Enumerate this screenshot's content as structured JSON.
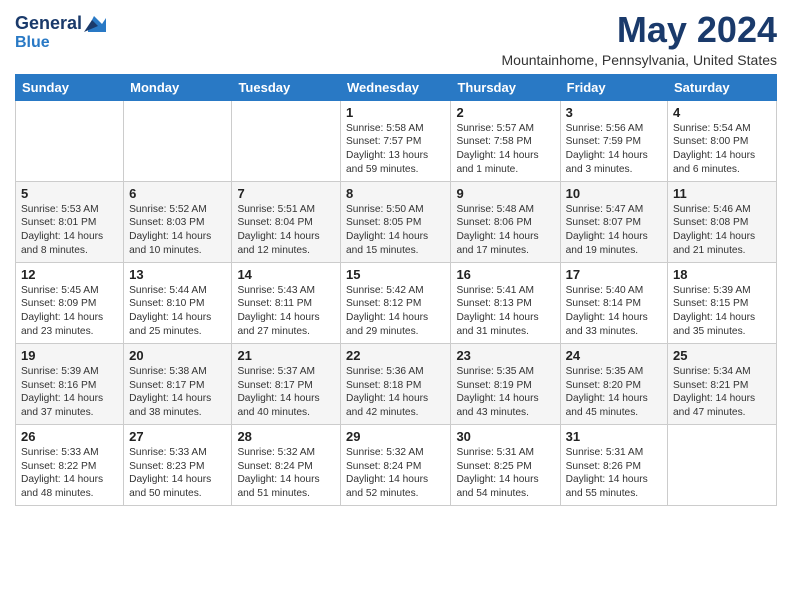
{
  "logo": {
    "line1": "General",
    "line2": "Blue"
  },
  "title": "May 2024",
  "location": "Mountainhome, Pennsylvania, United States",
  "days_of_week": [
    "Sunday",
    "Monday",
    "Tuesday",
    "Wednesday",
    "Thursday",
    "Friday",
    "Saturday"
  ],
  "weeks": [
    [
      {
        "day": "",
        "info": ""
      },
      {
        "day": "",
        "info": ""
      },
      {
        "day": "",
        "info": ""
      },
      {
        "day": "1",
        "info": "Sunrise: 5:58 AM\nSunset: 7:57 PM\nDaylight: 13 hours\nand 59 minutes."
      },
      {
        "day": "2",
        "info": "Sunrise: 5:57 AM\nSunset: 7:58 PM\nDaylight: 14 hours\nand 1 minute."
      },
      {
        "day": "3",
        "info": "Sunrise: 5:56 AM\nSunset: 7:59 PM\nDaylight: 14 hours\nand 3 minutes."
      },
      {
        "day": "4",
        "info": "Sunrise: 5:54 AM\nSunset: 8:00 PM\nDaylight: 14 hours\nand 6 minutes."
      }
    ],
    [
      {
        "day": "5",
        "info": "Sunrise: 5:53 AM\nSunset: 8:01 PM\nDaylight: 14 hours\nand 8 minutes."
      },
      {
        "day": "6",
        "info": "Sunrise: 5:52 AM\nSunset: 8:03 PM\nDaylight: 14 hours\nand 10 minutes."
      },
      {
        "day": "7",
        "info": "Sunrise: 5:51 AM\nSunset: 8:04 PM\nDaylight: 14 hours\nand 12 minutes."
      },
      {
        "day": "8",
        "info": "Sunrise: 5:50 AM\nSunset: 8:05 PM\nDaylight: 14 hours\nand 15 minutes."
      },
      {
        "day": "9",
        "info": "Sunrise: 5:48 AM\nSunset: 8:06 PM\nDaylight: 14 hours\nand 17 minutes."
      },
      {
        "day": "10",
        "info": "Sunrise: 5:47 AM\nSunset: 8:07 PM\nDaylight: 14 hours\nand 19 minutes."
      },
      {
        "day": "11",
        "info": "Sunrise: 5:46 AM\nSunset: 8:08 PM\nDaylight: 14 hours\nand 21 minutes."
      }
    ],
    [
      {
        "day": "12",
        "info": "Sunrise: 5:45 AM\nSunset: 8:09 PM\nDaylight: 14 hours\nand 23 minutes."
      },
      {
        "day": "13",
        "info": "Sunrise: 5:44 AM\nSunset: 8:10 PM\nDaylight: 14 hours\nand 25 minutes."
      },
      {
        "day": "14",
        "info": "Sunrise: 5:43 AM\nSunset: 8:11 PM\nDaylight: 14 hours\nand 27 minutes."
      },
      {
        "day": "15",
        "info": "Sunrise: 5:42 AM\nSunset: 8:12 PM\nDaylight: 14 hours\nand 29 minutes."
      },
      {
        "day": "16",
        "info": "Sunrise: 5:41 AM\nSunset: 8:13 PM\nDaylight: 14 hours\nand 31 minutes."
      },
      {
        "day": "17",
        "info": "Sunrise: 5:40 AM\nSunset: 8:14 PM\nDaylight: 14 hours\nand 33 minutes."
      },
      {
        "day": "18",
        "info": "Sunrise: 5:39 AM\nSunset: 8:15 PM\nDaylight: 14 hours\nand 35 minutes."
      }
    ],
    [
      {
        "day": "19",
        "info": "Sunrise: 5:39 AM\nSunset: 8:16 PM\nDaylight: 14 hours\nand 37 minutes."
      },
      {
        "day": "20",
        "info": "Sunrise: 5:38 AM\nSunset: 8:17 PM\nDaylight: 14 hours\nand 38 minutes."
      },
      {
        "day": "21",
        "info": "Sunrise: 5:37 AM\nSunset: 8:17 PM\nDaylight: 14 hours\nand 40 minutes."
      },
      {
        "day": "22",
        "info": "Sunrise: 5:36 AM\nSunset: 8:18 PM\nDaylight: 14 hours\nand 42 minutes."
      },
      {
        "day": "23",
        "info": "Sunrise: 5:35 AM\nSunset: 8:19 PM\nDaylight: 14 hours\nand 43 minutes."
      },
      {
        "day": "24",
        "info": "Sunrise: 5:35 AM\nSunset: 8:20 PM\nDaylight: 14 hours\nand 45 minutes."
      },
      {
        "day": "25",
        "info": "Sunrise: 5:34 AM\nSunset: 8:21 PM\nDaylight: 14 hours\nand 47 minutes."
      }
    ],
    [
      {
        "day": "26",
        "info": "Sunrise: 5:33 AM\nSunset: 8:22 PM\nDaylight: 14 hours\nand 48 minutes."
      },
      {
        "day": "27",
        "info": "Sunrise: 5:33 AM\nSunset: 8:23 PM\nDaylight: 14 hours\nand 50 minutes."
      },
      {
        "day": "28",
        "info": "Sunrise: 5:32 AM\nSunset: 8:24 PM\nDaylight: 14 hours\nand 51 minutes."
      },
      {
        "day": "29",
        "info": "Sunrise: 5:32 AM\nSunset: 8:24 PM\nDaylight: 14 hours\nand 52 minutes."
      },
      {
        "day": "30",
        "info": "Sunrise: 5:31 AM\nSunset: 8:25 PM\nDaylight: 14 hours\nand 54 minutes."
      },
      {
        "day": "31",
        "info": "Sunrise: 5:31 AM\nSunset: 8:26 PM\nDaylight: 14 hours\nand 55 minutes."
      },
      {
        "day": "",
        "info": ""
      }
    ]
  ]
}
